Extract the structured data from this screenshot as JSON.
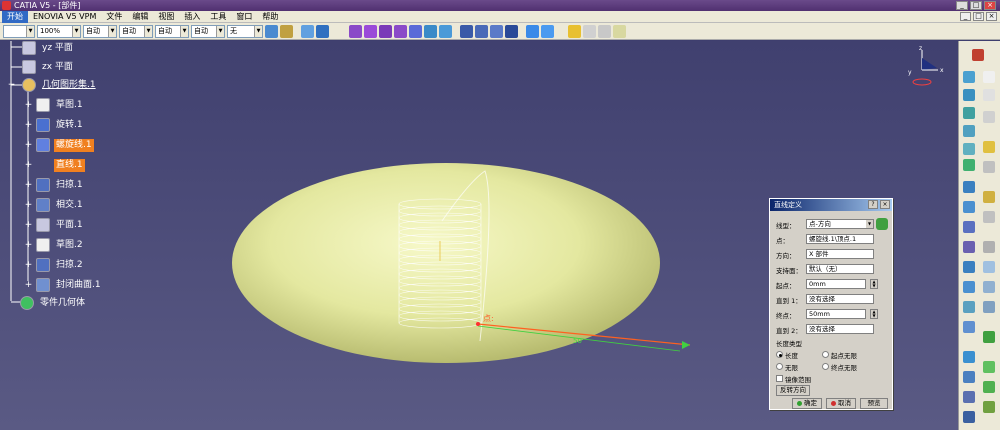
{
  "titlebar": {
    "title": "CATIA V5 - [部件]"
  },
  "menubar": {
    "items": [
      "开始",
      "ENOVIA V5 VPM",
      "文件",
      "编辑",
      "视图",
      "插入",
      "工具",
      "窗口",
      "帮助"
    ]
  },
  "toolbar": {
    "combos": [
      {
        "value": ""
      },
      {
        "value": "100%"
      },
      {
        "value": "自动"
      },
      {
        "value": "自动"
      },
      {
        "value": "自动"
      },
      {
        "value": "自动"
      },
      {
        "value": "无"
      }
    ]
  },
  "tree": {
    "items": [
      {
        "label": "yz 平面"
      },
      {
        "label": "zx 平面"
      },
      {
        "label": "几何图形集.1"
      },
      {
        "label": "草图.1"
      },
      {
        "label": "旋转.1"
      },
      {
        "label": "螺旋线.1"
      },
      {
        "label": "直线.1"
      },
      {
        "label": "扫掠.1"
      },
      {
        "label": "相交.1"
      },
      {
        "label": "平面.1"
      },
      {
        "label": "草图.2"
      },
      {
        "label": "扫掠.2"
      },
      {
        "label": "封闭曲面.1"
      },
      {
        "label": "零件几何体"
      }
    ]
  },
  "viewport": {
    "annotation_point": "点:",
    "annotation_length": "50"
  },
  "compass": {
    "x_label": "x",
    "y_label": "y",
    "z_label": "z"
  },
  "dialog": {
    "title": "直线定义",
    "type_label": "线型：",
    "type_value": "点-方向",
    "point_label": "点：",
    "point_value": "螺旋线.1\\顶点.1",
    "direction_label": "方向：",
    "direction_value": "X 部件",
    "support_label": "支持面：",
    "support_value": "默认（无）",
    "start_label": "起点：",
    "start_value": "0mm",
    "upto1_label": "直到 1：",
    "upto1_value": "没有选择",
    "end_label": "终点：",
    "end_value": "50mm",
    "upto2_label": "直到 2：",
    "upto2_value": "没有选择",
    "length_type_label": "长度类型",
    "radio_length": "长度",
    "radio_start_infinite": "起点无限",
    "radio_infinite": "无限",
    "radio_end_infinite": "终点无限",
    "mirror_label": "镜像范围",
    "reverse_button": "反转方向",
    "ok_button": "确定",
    "cancel_button": "取消",
    "preview_button": "预览"
  }
}
